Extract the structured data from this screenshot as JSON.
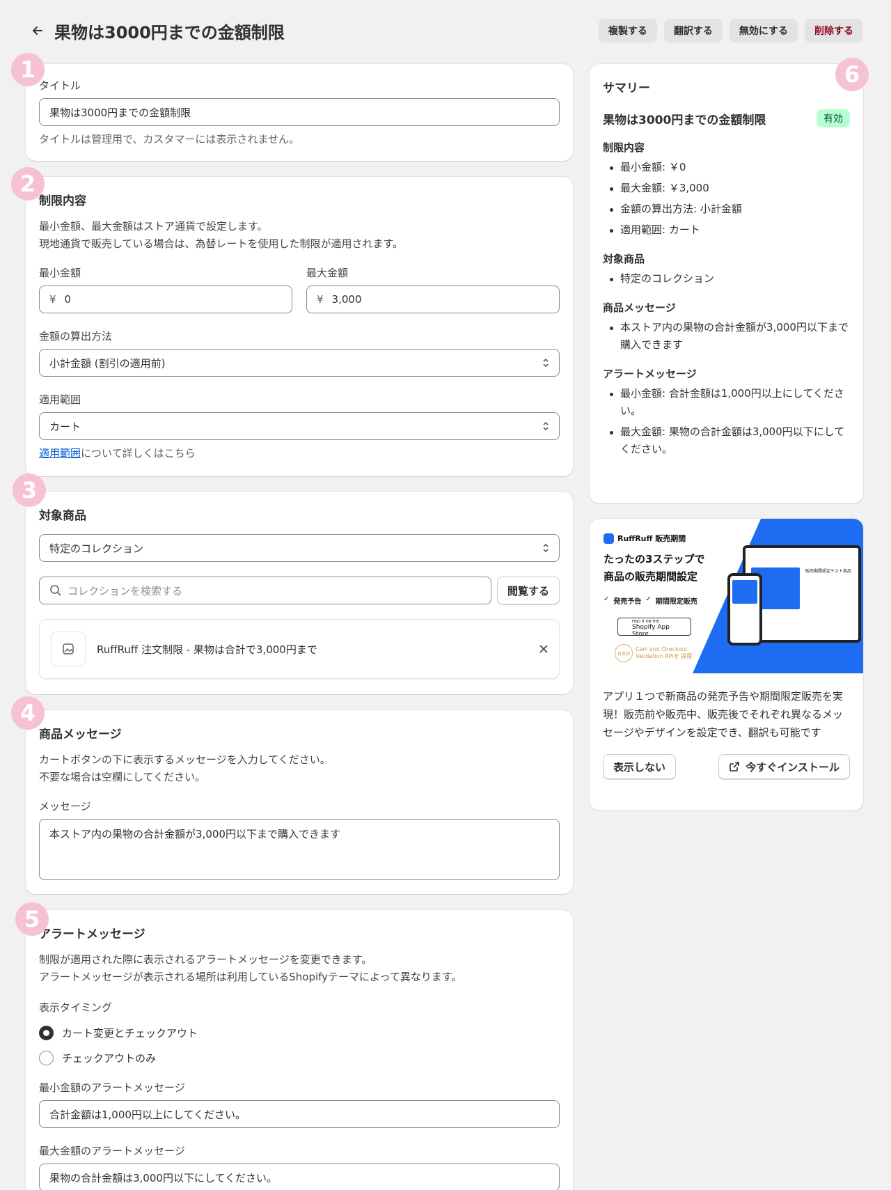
{
  "header": {
    "title": "果物は3000円までの金額制限",
    "actions": [
      "複製する",
      "翻訳する",
      "無効にする",
      "削除する"
    ]
  },
  "badges": [
    "1",
    "2",
    "3",
    "4",
    "5",
    "6"
  ],
  "title_card": {
    "label": "タイトル",
    "value": "果物は3000円までの金額制限",
    "help": "タイトルは管理用で、カスタマーには表示されません。"
  },
  "limit_card": {
    "heading": "制限内容",
    "desc1": "最小金額、最大金額はストア通貨で設定します。",
    "desc2": "現地通貨で販売している場合は、為替レートを使用した制限が適用されます。",
    "min_label": "最小金額",
    "min_prefix": "¥",
    "min_value": "0",
    "max_label": "最大金額",
    "max_prefix": "¥",
    "max_value": "3,000",
    "calc_label": "金額の算出方法",
    "calc_value": "小計金額 (割引の適用前)",
    "scope_label": "適用範囲",
    "scope_value": "カート",
    "help_link": "適用範囲",
    "help_rest": "について詳しくはこちら"
  },
  "products_card": {
    "heading": "対象商品",
    "select_value": "特定のコレクション",
    "search_placeholder": "コレクションを検索する",
    "browse_label": "閲覧する",
    "item_name": "RuffRuff 注文制限 - 果物は合計で3,000円まで"
  },
  "message_card": {
    "heading": "商品メッセージ",
    "desc1": "カートボタンの下に表示するメッセージを入力してください。",
    "desc2": "不要な場合は空欄にしてください。",
    "label": "メッセージ",
    "value": "本ストア内の果物の合計金額が3,000円以下まで購入できます"
  },
  "alert_card": {
    "heading": "アラートメッセージ",
    "desc1": "制限が適用された際に表示されるアラートメッセージを変更できます。",
    "desc2": "アラートメッセージが表示される場所は利用しているShopifyテーマによって異なります。",
    "timing_label": "表示タイミング",
    "option1": "カート変更とチェックアウト",
    "option2": "チェックアウトのみ",
    "min_label": "最小金額のアラートメッセージ",
    "min_value": "合計金額は1,000円以上にしてください。",
    "max_label": "最大金額のアラートメッセージ",
    "max_value": "果物の合計金額は3,000円以下にしてください。"
  },
  "summary": {
    "title": "サマリー",
    "name": "果物は3000円までの金額制限",
    "status": "有効",
    "limit_heading": "制限内容",
    "limit_items": [
      "最小金額: ￥0",
      "最大金額: ￥3,000",
      "金額の算出方法: 小計金額",
      "適用範囲: カート"
    ],
    "products_heading": "対象商品",
    "products_items": [
      "特定のコレクション"
    ],
    "message_heading": "商品メッセージ",
    "message_items": [
      "本ストア内の果物の合計金額が3,000円以下まで購入できます"
    ],
    "alert_heading": "アラートメッセージ",
    "alert_items": [
      "最小金額: 合計金額は1,000円以上にしてください。",
      "最大金額: 果物の合計金額は3,000円以下にしてください。"
    ]
  },
  "promo": {
    "brand": "RuffRuff 販売期間",
    "headline1": "たったの3ステップで",
    "headline2": "商品の販売期間設定",
    "tag1": "発売予告",
    "tag2": "期間限定販売",
    "store_small": "FIND IT ON THE",
    "store_name": "Shopify App Store",
    "award_line1": "Cart and Checkout",
    "award_line2": "Validation APIを 採用",
    "award_mark": "日本初",
    "mock_title": "販売期間設定テスト商品",
    "body": "アプリ１つで新商品の発売予告や期間限定販売を実現！販売前や販売中、販売後でそれぞれ異なるメッセージやデザインを設定でき、翻訳も可能です",
    "hide_label": "表示しない",
    "install_label": "今すぐインストール"
  }
}
